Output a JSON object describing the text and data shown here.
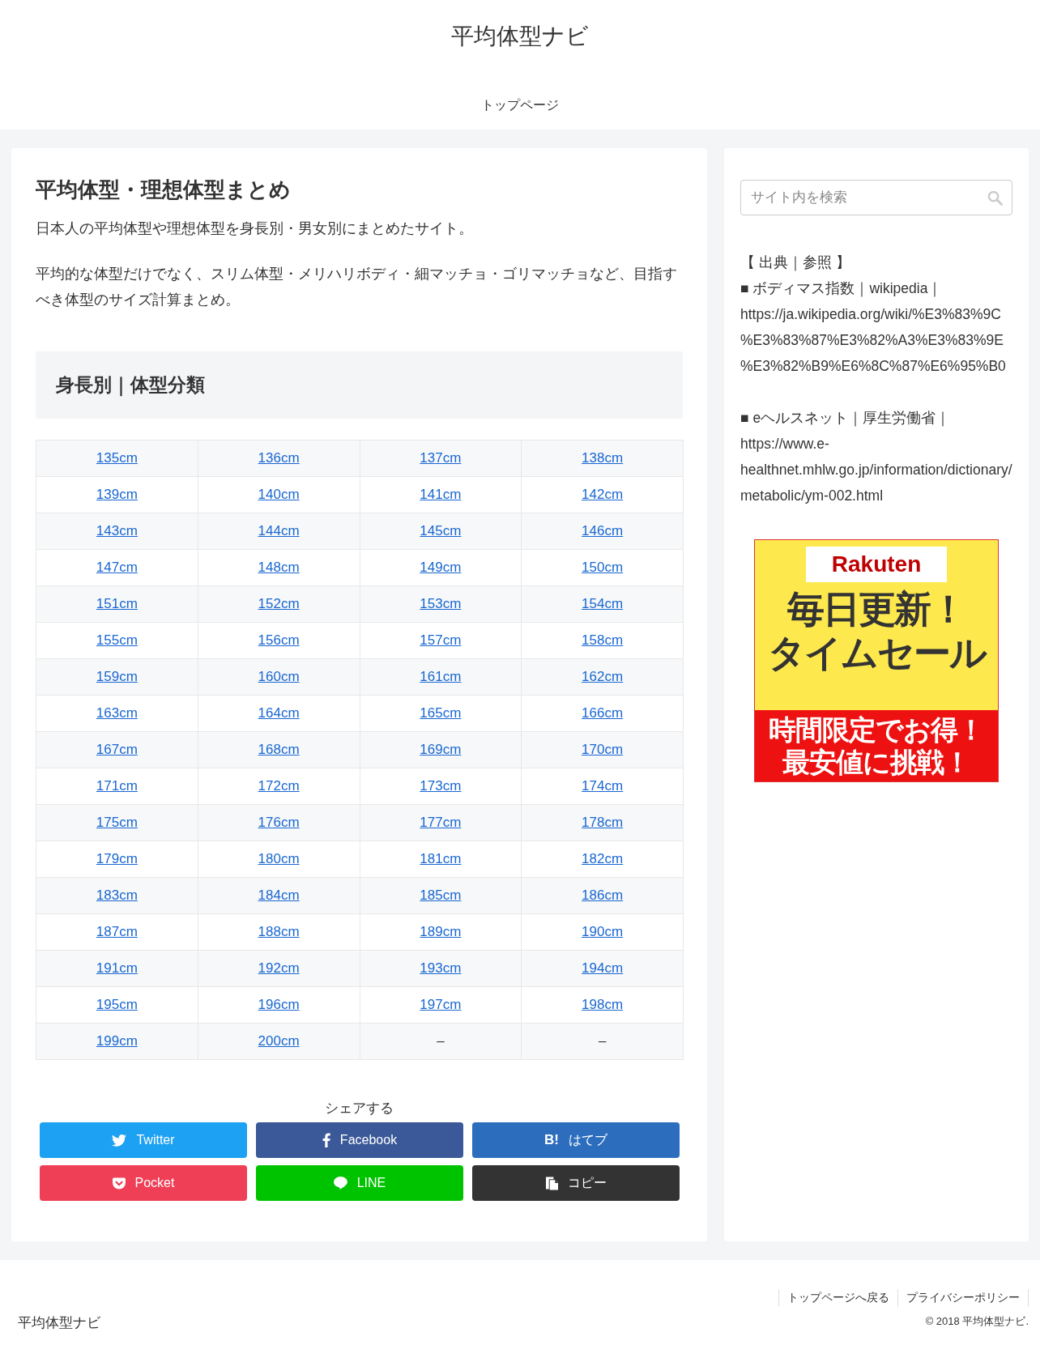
{
  "header": {
    "site_title": "平均体型ナビ",
    "nav": [
      {
        "label": "トップページ"
      }
    ]
  },
  "article": {
    "title": "平均体型・理想体型まとめ",
    "paragraphs": [
      "日本人の平均体型や理想体型を身長別・男女別にまとめたサイト。",
      "平均的な体型だけでなく、スリム体型・メリハリボディ・細マッチョ・ゴリマッチョなど、目指すべき体型のサイズ計算まとめ。"
    ],
    "section_heading": "身長別｜体型分類",
    "table": {
      "rows": [
        [
          {
            "kind": "link",
            "text": "135cm"
          },
          {
            "kind": "link",
            "text": "136cm"
          },
          {
            "kind": "link",
            "text": "137cm"
          },
          {
            "kind": "link",
            "text": "138cm"
          }
        ],
        [
          {
            "kind": "link",
            "text": "139cm"
          },
          {
            "kind": "link",
            "text": "140cm"
          },
          {
            "kind": "link",
            "text": "141cm"
          },
          {
            "kind": "link",
            "text": "142cm"
          }
        ],
        [
          {
            "kind": "link",
            "text": "143cm"
          },
          {
            "kind": "link",
            "text": "144cm"
          },
          {
            "kind": "link",
            "text": "145cm"
          },
          {
            "kind": "link",
            "text": "146cm"
          }
        ],
        [
          {
            "kind": "link",
            "text": "147cm"
          },
          {
            "kind": "link",
            "text": "148cm"
          },
          {
            "kind": "link",
            "text": "149cm"
          },
          {
            "kind": "link",
            "text": "150cm"
          }
        ],
        [
          {
            "kind": "link",
            "text": "151cm"
          },
          {
            "kind": "link",
            "text": "152cm"
          },
          {
            "kind": "link",
            "text": "153cm"
          },
          {
            "kind": "link",
            "text": "154cm"
          }
        ],
        [
          {
            "kind": "link",
            "text": "155cm"
          },
          {
            "kind": "link",
            "text": "156cm"
          },
          {
            "kind": "link",
            "text": "157cm"
          },
          {
            "kind": "link",
            "text": "158cm"
          }
        ],
        [
          {
            "kind": "link",
            "text": "159cm"
          },
          {
            "kind": "link",
            "text": "160cm"
          },
          {
            "kind": "link",
            "text": "161cm"
          },
          {
            "kind": "link",
            "text": "162cm"
          }
        ],
        [
          {
            "kind": "link",
            "text": "163cm"
          },
          {
            "kind": "link",
            "text": "164cm"
          },
          {
            "kind": "link",
            "text": "165cm"
          },
          {
            "kind": "link",
            "text": "166cm"
          }
        ],
        [
          {
            "kind": "link",
            "text": "167cm"
          },
          {
            "kind": "link",
            "text": "168cm"
          },
          {
            "kind": "link",
            "text": "169cm"
          },
          {
            "kind": "link",
            "text": "170cm"
          }
        ],
        [
          {
            "kind": "link",
            "text": "171cm"
          },
          {
            "kind": "link",
            "text": "172cm"
          },
          {
            "kind": "link",
            "text": "173cm"
          },
          {
            "kind": "link",
            "text": "174cm"
          }
        ],
        [
          {
            "kind": "link",
            "text": "175cm"
          },
          {
            "kind": "link",
            "text": "176cm"
          },
          {
            "kind": "link",
            "text": "177cm"
          },
          {
            "kind": "link",
            "text": "178cm"
          }
        ],
        [
          {
            "kind": "link",
            "text": "179cm"
          },
          {
            "kind": "link",
            "text": "180cm"
          },
          {
            "kind": "link",
            "text": "181cm"
          },
          {
            "kind": "link",
            "text": "182cm"
          }
        ],
        [
          {
            "kind": "link",
            "text": "183cm"
          },
          {
            "kind": "link",
            "text": "184cm"
          },
          {
            "kind": "link",
            "text": "185cm"
          },
          {
            "kind": "link",
            "text": "186cm"
          }
        ],
        [
          {
            "kind": "link",
            "text": "187cm"
          },
          {
            "kind": "link",
            "text": "188cm"
          },
          {
            "kind": "link",
            "text": "189cm"
          },
          {
            "kind": "link",
            "text": "190cm"
          }
        ],
        [
          {
            "kind": "link",
            "text": "191cm"
          },
          {
            "kind": "link",
            "text": "192cm"
          },
          {
            "kind": "link",
            "text": "193cm"
          },
          {
            "kind": "link",
            "text": "194cm"
          }
        ],
        [
          {
            "kind": "link",
            "text": "195cm"
          },
          {
            "kind": "link",
            "text": "196cm"
          },
          {
            "kind": "link",
            "text": "197cm"
          },
          {
            "kind": "link",
            "text": "198cm"
          }
        ],
        [
          {
            "kind": "link",
            "text": "199cm"
          },
          {
            "kind": "link",
            "text": "200cm"
          },
          {
            "kind": "text",
            "text": "–"
          },
          {
            "kind": "text",
            "text": "–"
          }
        ]
      ]
    },
    "share": {
      "label": "シェアする",
      "buttons": [
        {
          "kind": "twitter",
          "label": "Twitter"
        },
        {
          "kind": "facebook",
          "label": "Facebook"
        },
        {
          "kind": "hatena",
          "label": "はてブ",
          "icon_text": "B!"
        },
        {
          "kind": "pocket",
          "label": "Pocket"
        },
        {
          "kind": "line",
          "label": "LINE"
        },
        {
          "kind": "copy",
          "label": "コピー"
        }
      ]
    }
  },
  "sidebar": {
    "search": {
      "placeholder": "サイト内を検索"
    },
    "sources": {
      "title": "【 出典｜参照 】",
      "items": [
        {
          "label": "■ ボディマス指数｜wikipedia｜",
          "url": "https://ja.wikipedia.org/wiki/%E3%83%9C%E3%83%87%E3%82%A3%E3%83%9E%E3%82%B9%E6%8C%87%E6%95%B0"
        },
        {
          "label": "■ eヘルスネット｜厚生労働省｜",
          "url": "https://www.e-healthnet.mhlw.go.jp/information/dictionary/metabolic/ym-002.html"
        }
      ]
    },
    "ad": {
      "logo": "Rakuten",
      "headline": [
        "毎日更新！",
        "タイムセール"
      ],
      "subline": [
        "時間限定でお得！",
        "最安値に挑戦！"
      ]
    }
  },
  "footer": {
    "links": [
      "トップページへ戻る",
      "プライバシーポリシー"
    ],
    "site_name": "平均体型ナビ",
    "copyright": "© 2018 平均体型ナビ."
  }
}
